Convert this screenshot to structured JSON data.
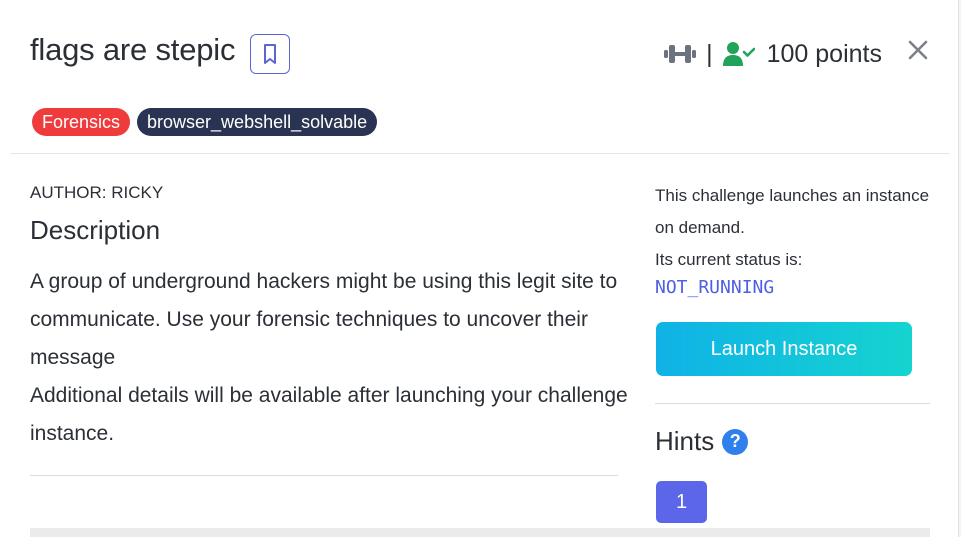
{
  "challenge": {
    "title": "flags are stepic",
    "points": "100 points",
    "separator": "|",
    "tags": [
      "Forensics",
      "browser_webshell_solvable"
    ],
    "author": "AUTHOR: RICKY",
    "description_heading": "Description",
    "description_lines": [
      "A group of underground hackers might be using this legit site to communicate. Use your forensic techniques to uncover their message",
      "Additional details will be available after launching your challenge instance."
    ]
  },
  "instance": {
    "intro": "This challenge launches an instance on demand.",
    "status_label": "Its current status is:",
    "status_value": "NOT_RUNNING",
    "launch_label": "Launch Instance"
  },
  "hints": {
    "heading": "Hints",
    "help_glyph": "?",
    "items": [
      "1"
    ]
  },
  "icons": {
    "bookmark": "bookmark-icon",
    "difficulty": "dumbbell-icon",
    "solved": "user-check-icon",
    "close": "close-icon",
    "help": "question-circle-icon"
  },
  "colors": {
    "accent": "#5b66e8",
    "tag_category": "#ef3b3b",
    "tag_dark": "#2a3452",
    "status": "#4d5fe6",
    "success": "#22a35a",
    "launch_gradient_start": "#0fb2e6",
    "launch_gradient_end": "#15d4d0"
  }
}
